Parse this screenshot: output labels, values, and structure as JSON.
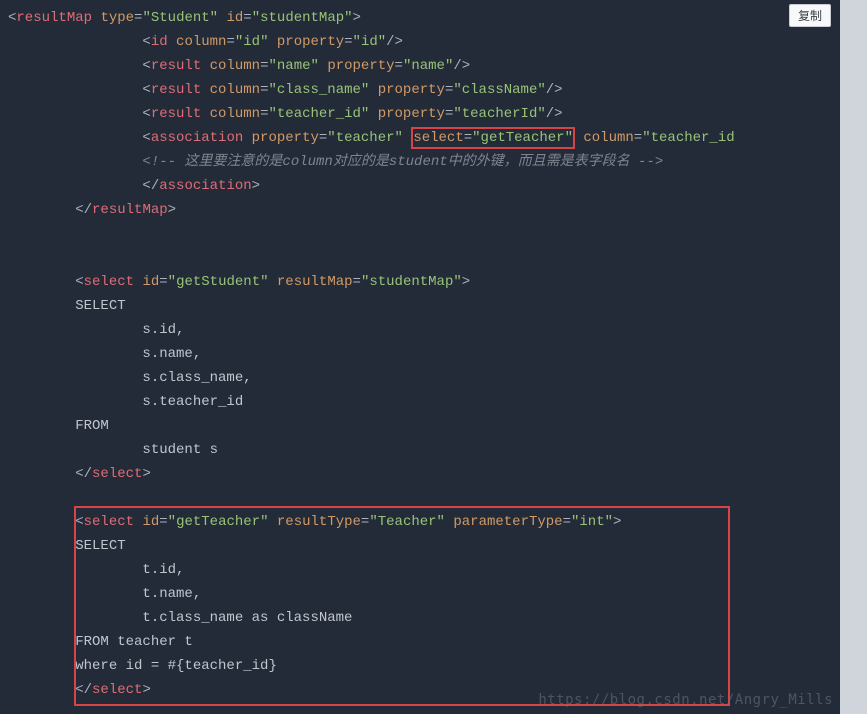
{
  "copy_button": "复制",
  "watermark": "https://blog.csdn.net/Angry_Mills",
  "code": {
    "l1": {
      "tag": "resultMap",
      "attrs": [
        [
          "type",
          "Student"
        ],
        [
          "id",
          "studentMap"
        ]
      ]
    },
    "l2": {
      "tag": "id",
      "attrs": [
        [
          "column",
          "id"
        ],
        [
          "property",
          "id"
        ]
      ],
      "selfclose": true,
      "indent": 16
    },
    "l3": {
      "tag": "result",
      "attrs": [
        [
          "column",
          "name"
        ],
        [
          "property",
          "name"
        ]
      ],
      "selfclose": true,
      "indent": 16
    },
    "l4": {
      "tag": "result",
      "attrs": [
        [
          "column",
          "class_name"
        ],
        [
          "property",
          "className"
        ]
      ],
      "selfclose": true,
      "indent": 16
    },
    "l5": {
      "tag": "result",
      "attrs": [
        [
          "column",
          "teacher_id"
        ],
        [
          "property",
          "teacherId"
        ]
      ],
      "selfclose": true,
      "indent": 16
    },
    "l6a": {
      "tag": "association",
      "attrs": [
        [
          "property",
          "teacher"
        ]
      ],
      "indent": 16
    },
    "l6b": {
      "boxattr": [
        "select",
        "getTeacher"
      ]
    },
    "l6c": {
      "attrs": [
        [
          "column",
          "teacher_id"
        ]
      ]
    },
    "l7": {
      "comment": "<!-- 这里要注意的是column对应的是student中的外键，而且需是表字段名 -->",
      "indent": 16
    },
    "l8": {
      "closetag": "association",
      "indent": 16
    },
    "l9": {
      "closetag": "resultMap",
      "indent": 8
    },
    "l12": {
      "tag": "select",
      "attrs": [
        [
          "id",
          "getStudent"
        ],
        [
          "resultMap",
          "studentMap"
        ]
      ],
      "indent": 8
    },
    "sql1": [
      "        SELECT",
      "                s.id,",
      "                s.name,",
      "                s.class_name,",
      "                s.teacher_id",
      "        FROM",
      "                student s"
    ],
    "l20": {
      "closetag": "select",
      "indent": 8
    },
    "l23": {
      "tag": "select",
      "attrs": [
        [
          "id",
          "getTeacher"
        ],
        [
          "resultType",
          "Teacher"
        ],
        [
          "parameterType",
          "int"
        ]
      ],
      "indent": 8
    },
    "sql2": [
      "        SELECT",
      "                t.id,",
      "                t.name,",
      "                t.class_name as className",
      "        FROM teacher t",
      "        where id = #{teacher_id}"
    ],
    "l30": {
      "closetag": "select",
      "indent": 8
    }
  }
}
